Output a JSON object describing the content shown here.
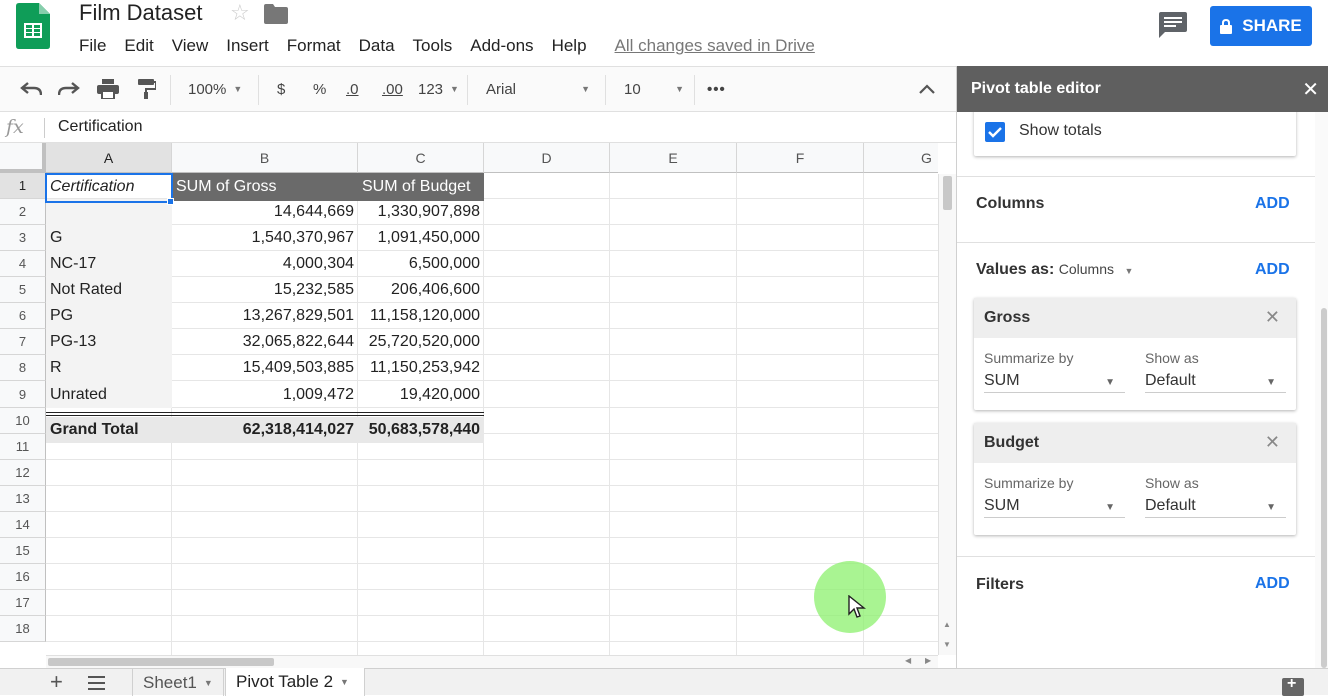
{
  "app": {
    "doc_title": "Film Dataset",
    "menu": [
      "File",
      "Edit",
      "View",
      "Insert",
      "Format",
      "Data",
      "Tools",
      "Add-ons",
      "Help"
    ],
    "save_status": "All changes saved in Drive",
    "share_label": "SHARE",
    "accent_color": "#1a73e8"
  },
  "toolbar": {
    "zoom": "100%",
    "currency": "$",
    "percent": "%",
    "decrease_decimals": ".0",
    "increase_decimals": ".00",
    "more_formats": "123",
    "font": "Arial",
    "font_size": "10",
    "more": "•••"
  },
  "formula_bar": {
    "fx": "fx",
    "value": "Certification"
  },
  "grid": {
    "columns": [
      "A",
      "B",
      "C",
      "D",
      "E",
      "F",
      "G"
    ],
    "rows": [
      "1",
      "2",
      "3",
      "4",
      "5",
      "6",
      "7",
      "8",
      "9",
      "10",
      "11",
      "12",
      "13",
      "14",
      "15",
      "16",
      "17",
      "18"
    ],
    "pivot_header": [
      "Certification",
      "SUM of Gross",
      "SUM of Budget"
    ],
    "pivot_rows": [
      [
        "",
        "14,644,669",
        "1,330,907,898"
      ],
      [
        "G",
        "1,540,370,967",
        "1,091,450,000"
      ],
      [
        "NC-17",
        "4,000,304",
        "6,500,000"
      ],
      [
        "Not Rated",
        "15,232,585",
        "206,406,600"
      ],
      [
        "PG",
        "13,267,829,501",
        "11,158,120,000"
      ],
      [
        "PG-13",
        "32,065,822,644",
        "25,720,520,000"
      ],
      [
        "R",
        "15,409,503,885",
        "11,150,253,942"
      ],
      [
        "Unrated",
        "1,009,472",
        "19,420,000"
      ]
    ],
    "grand_total": [
      "Grand Total",
      "62,318,414,027",
      "50,683,578,440"
    ]
  },
  "sheets": {
    "tabs": [
      "Sheet1",
      "Pivot Table 2"
    ],
    "active": "Pivot Table 2"
  },
  "pivot_editor": {
    "title": "Pivot table editor",
    "show_totals_label": "Show totals",
    "show_totals_checked": true,
    "columns_title": "Columns",
    "values_title": "Values as:",
    "values_mode": "Columns",
    "filters_title": "Filters",
    "add_label": "ADD",
    "value_cards": [
      {
        "name": "Gross",
        "summarize_label": "Summarize by",
        "summarize_value": "SUM",
        "show_as_label": "Show as",
        "show_as_value": "Default"
      },
      {
        "name": "Budget",
        "summarize_label": "Summarize by",
        "summarize_value": "SUM",
        "show_as_label": "Show as",
        "show_as_value": "Default"
      }
    ]
  },
  "icons": [
    "sheets-logo-icon",
    "star-icon",
    "folder-icon",
    "comments-icon",
    "lock-icon",
    "undo-icon",
    "redo-icon",
    "print-icon",
    "paint-format-icon",
    "collapse-icon",
    "close-icon",
    "checkbox-icon",
    "add-sheet-icon",
    "all-sheets-icon",
    "explore-icon",
    "mouse-cursor-icon"
  ]
}
